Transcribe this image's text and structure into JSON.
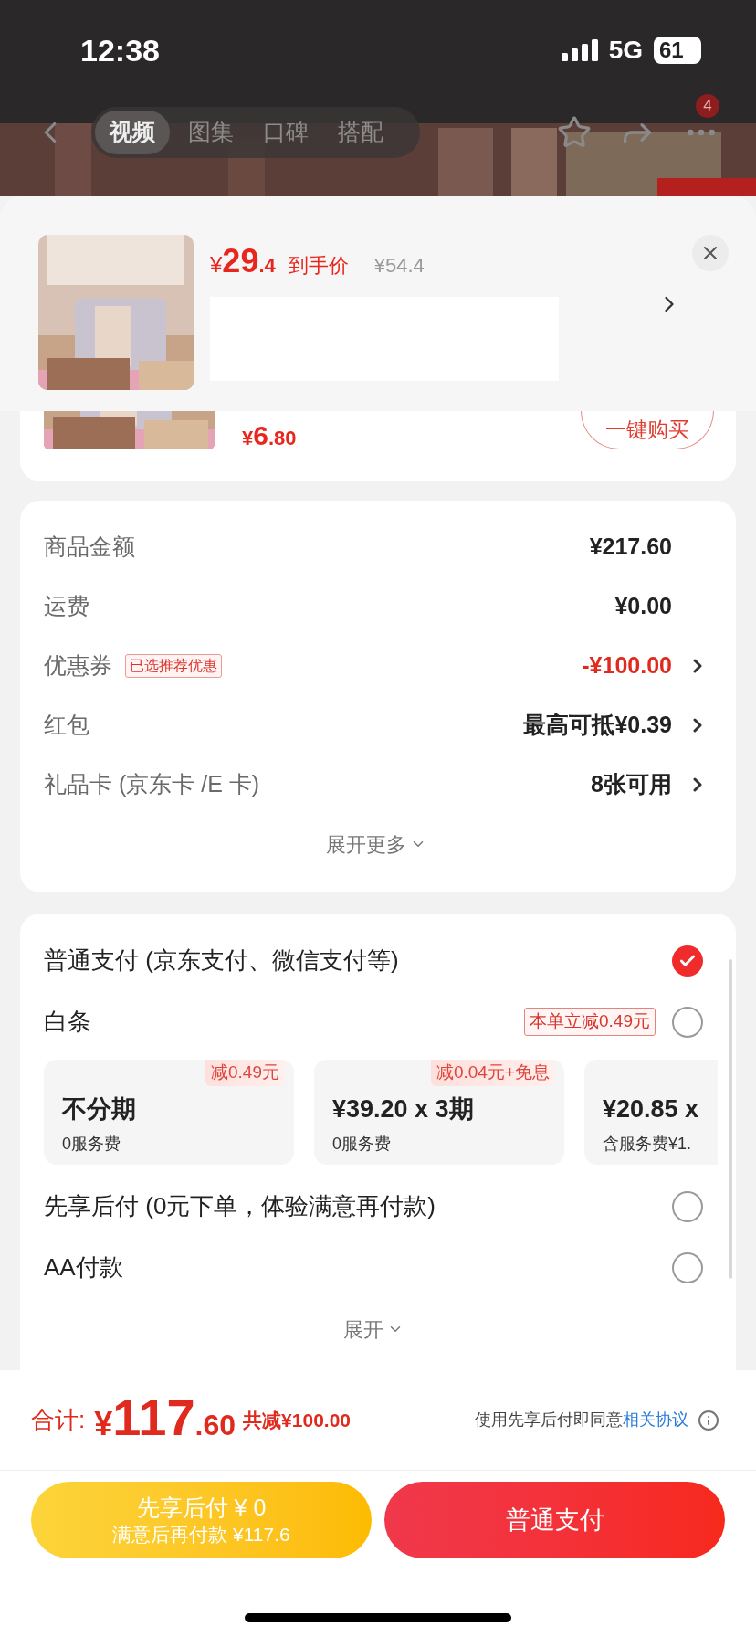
{
  "status_bar": {
    "time": "12:38",
    "network": "5G",
    "battery": "61"
  },
  "nav": {
    "tabs": [
      {
        "label": "视频",
        "selected": true
      },
      {
        "label": "图集",
        "selected": false
      },
      {
        "label": "口碑",
        "selected": false
      },
      {
        "label": "搭配",
        "selected": false
      }
    ],
    "badge": "4"
  },
  "product_header": {
    "price_symbol": "¥",
    "price_int": "29",
    "price_dec": ".4",
    "price_label": "到手价",
    "original_price": "¥54.4"
  },
  "bundle_item": {
    "price_symbol": "¥",
    "price_int": "6",
    "price_dec": ".80",
    "button": "一键购买"
  },
  "summary": {
    "rows": [
      {
        "label": "商品金额",
        "value": "¥217.60",
        "discount": false,
        "chevron": false
      },
      {
        "label": "运费",
        "value": "¥0.00",
        "discount": false,
        "chevron": false
      },
      {
        "label": "优惠券",
        "tag": "已选推荐优惠",
        "value": "-¥100.00",
        "discount": true,
        "chevron": true
      },
      {
        "label": "红包",
        "value": "最高可抵¥0.39",
        "discount": false,
        "chevron": true
      },
      {
        "label": "礼品卡 (京东卡 /E 卡)",
        "value": "8张可用",
        "discount": false,
        "chevron": true
      }
    ],
    "expand": "展开更多"
  },
  "payment": {
    "options": [
      {
        "label": "普通支付 (京东支付、微信支付等)",
        "selected": true
      },
      {
        "label": "白条",
        "tag": "本单立减0.49元",
        "selected": false,
        "plans": [
          {
            "badge": "减0.49元",
            "title": "不分期",
            "note": "0服务费"
          },
          {
            "badge": "减0.04元+免息",
            "title": "¥39.20 x 3期",
            "note": "0服务费"
          },
          {
            "title": "¥20.85 x",
            "note": "含服务费¥1."
          }
        ]
      },
      {
        "label": "先享后付 (0元下单，体验满意再付款)",
        "selected": false
      },
      {
        "label": "AA付款",
        "selected": false
      }
    ],
    "expand": "展开"
  },
  "footer": {
    "total_label": "合计:",
    "total_symbol": "¥",
    "total_int": "117",
    "total_dec": ".60",
    "saved": "共减¥100.00",
    "agreement_text": "使用先享后付即同意",
    "agreement_link": "相关协议",
    "buttons": [
      {
        "kind": "later",
        "line1": "先享后付 ¥ 0",
        "line2": "满意后再付款 ¥117.6"
      },
      {
        "kind": "primary",
        "label": "普通支付"
      }
    ]
  }
}
